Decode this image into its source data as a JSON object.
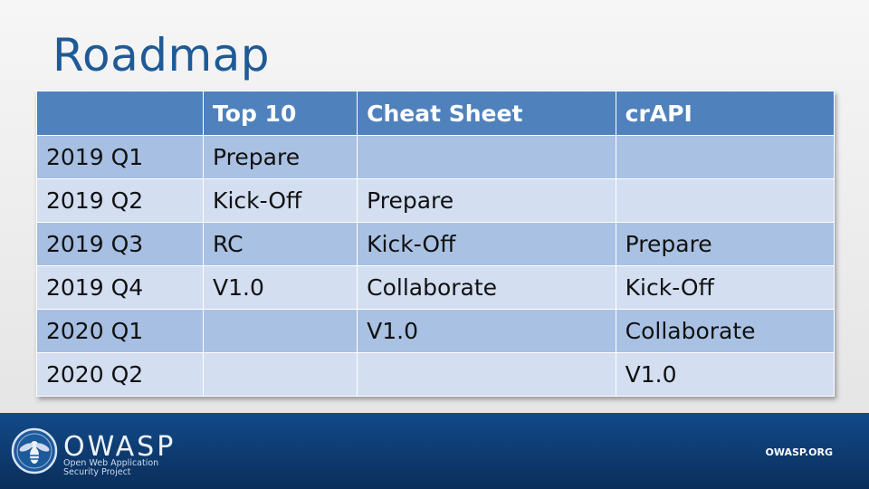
{
  "title": "Roadmap",
  "table": {
    "headers": [
      "",
      "Top 10",
      "Cheat Sheet",
      "crAPI"
    ],
    "rows": [
      [
        "2019 Q1",
        "Prepare",
        "",
        ""
      ],
      [
        "2019 Q2",
        "Kick-Off",
        "Prepare",
        ""
      ],
      [
        "2019 Q3",
        "RC",
        "Kick-Off",
        "Prepare"
      ],
      [
        "2019 Q4",
        "V1.0",
        "Collaborate",
        "Kick-Off"
      ],
      [
        "2020 Q1",
        "",
        "V1.0",
        "Collaborate"
      ],
      [
        "2020 Q2",
        "",
        "",
        "V1.0"
      ]
    ]
  },
  "footer": {
    "logo_word": "OWASP",
    "logo_tagline_1": "Open Web Application",
    "logo_tagline_2": "Security Project",
    "url": "OWASP.ORG"
  },
  "colors": {
    "title": "#1f5a96",
    "header_bg": "#4f81bd",
    "row_odd": "#a9c1e3",
    "row_even": "#d3def1",
    "footer_bg": "#124a8a"
  },
  "icons": {
    "logo": "wasp-emblem-icon"
  }
}
